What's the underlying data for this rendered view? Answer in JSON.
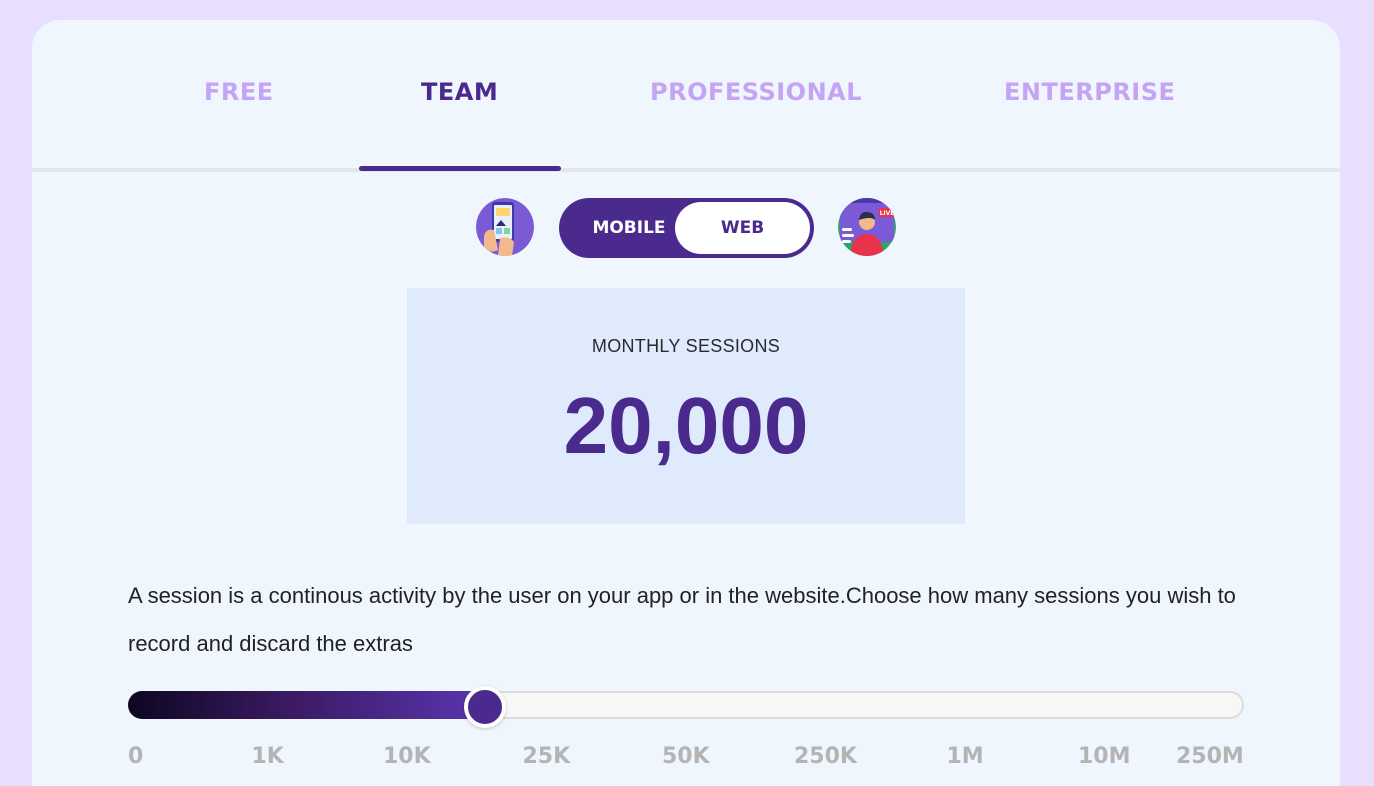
{
  "tabs": [
    {
      "label": "FREE",
      "active": false
    },
    {
      "label": "TEAM",
      "active": true
    },
    {
      "label": "PROFESSIONAL",
      "active": false
    },
    {
      "label": "ENTERPRISE",
      "active": false
    }
  ],
  "platform_toggle": {
    "mobile_label": "MOBILE",
    "web_label": "WEB",
    "selected": "WEB"
  },
  "web_icon": {
    "badge_text": "LIVE"
  },
  "sessions": {
    "label": "MONTHLY SESSIONS",
    "value": "20,000"
  },
  "description": "A session is a continous activity by the user on your app or in the website.Choose how many sessions you wish to record and discard the extras",
  "slider": {
    "ticks": [
      "0",
      "1K",
      "10K",
      "25K",
      "50K",
      "250K",
      "1M",
      "10M",
      "250M"
    ],
    "value_fraction": 0.32
  },
  "colors": {
    "accent": "#4a2a8d",
    "inactive_tab": "#c5a4f6",
    "background": "#e8defe",
    "card": "#eff6fe",
    "sessions_box": "#dfebfd"
  }
}
